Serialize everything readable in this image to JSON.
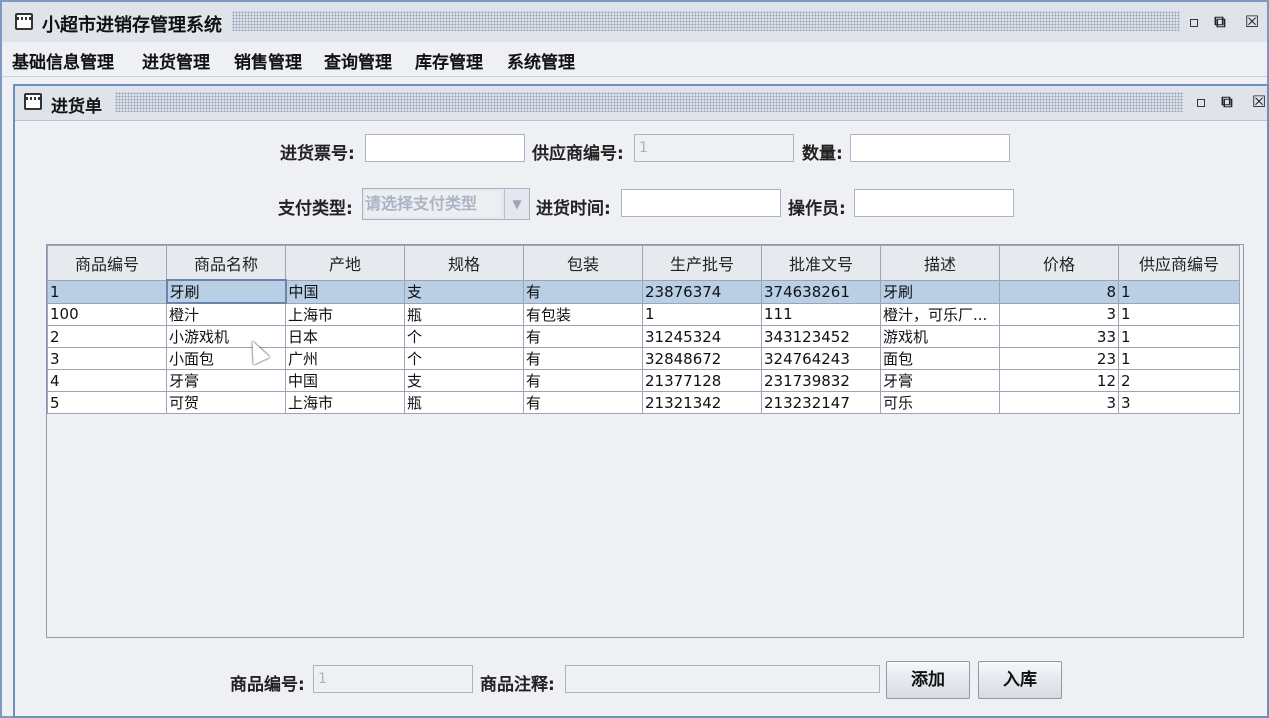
{
  "app": {
    "title": "小超市进销存管理系统",
    "controls": {
      "minimize": "▫",
      "maximize": "⧉",
      "close": "☒"
    }
  },
  "menu": [
    "基础信息管理",
    "进货管理",
    "销售管理",
    "查询管理",
    "库存管理",
    "系统管理"
  ],
  "dialog": {
    "title": "进货单",
    "form": {
      "invoice_label": "进货票号:",
      "invoice_value": "",
      "supplier_label": "供应商编号:",
      "supplier_value": "1",
      "quantity_label": "数量:",
      "quantity_value": "",
      "payment_label": "支付类型:",
      "payment_placeholder": "请选择支付类型",
      "time_label": "进货时间:",
      "time_value": "",
      "operator_label": "操作员:",
      "operator_value": ""
    },
    "table": {
      "columns": [
        "商品编号",
        "商品名称",
        "产地",
        "规格",
        "包装",
        "生产批号",
        "批准文号",
        "描述",
        "价格",
        "供应商编号"
      ],
      "rows": [
        [
          "1",
          "牙刷",
          "中国",
          "支",
          "有",
          "23876374",
          "374638261",
          "牙刷",
          "8",
          "1"
        ],
        [
          "100",
          "橙汁",
          "上海市",
          "瓶",
          "有包装",
          "1",
          "111",
          "橙汁，可乐厂...",
          "3",
          "1"
        ],
        [
          "2",
          "小游戏机",
          "日本",
          "个",
          "有",
          "31245324",
          "343123452",
          "游戏机",
          "33",
          "1"
        ],
        [
          "3",
          "小面包",
          "广州",
          "个",
          "有",
          "32848672",
          "324764243",
          "面包",
          "23",
          "1"
        ],
        [
          "4",
          "牙膏",
          "中国",
          "支",
          "有",
          "21377128",
          "231739832",
          "牙膏",
          "12",
          "2"
        ],
        [
          "5",
          "可贺",
          "上海市",
          "瓶",
          "有",
          "21321342",
          "213232147",
          "可乐",
          "3",
          "3"
        ]
      ],
      "selected_row": 0
    },
    "footer": {
      "product_id_label": "商品编号:",
      "product_id_value": "1",
      "note_label": "商品注释:",
      "note_value": "",
      "add_button": "添加",
      "stock_button": "入库"
    }
  }
}
